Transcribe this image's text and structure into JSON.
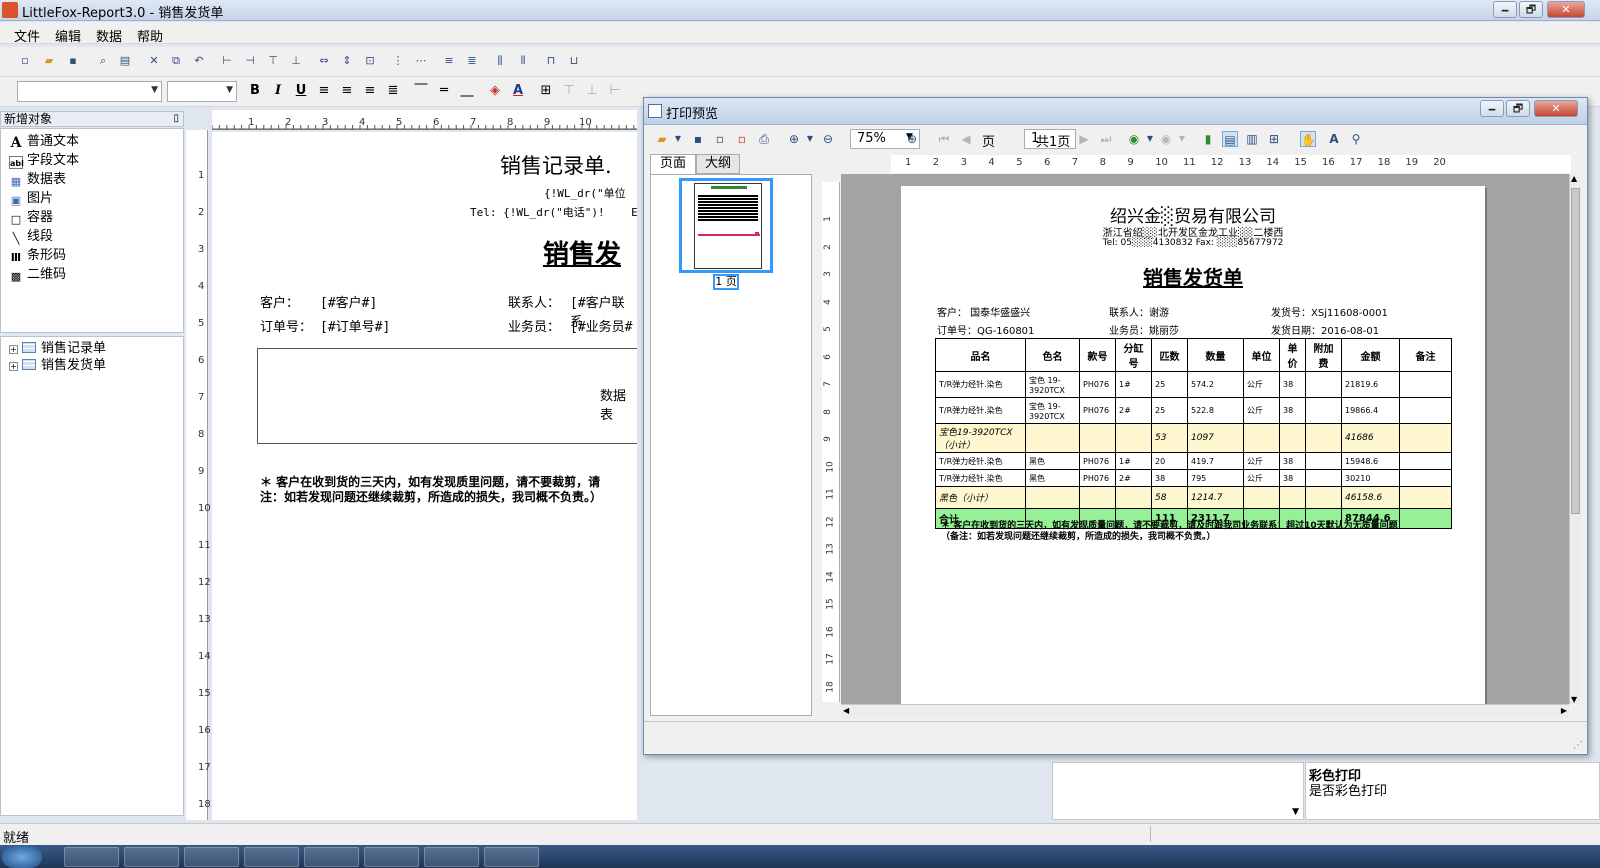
{
  "window": {
    "title": "LittleFox-Report3.0 - 销售发货单",
    "min": "🗕",
    "max": "🗗",
    "close": "✕"
  },
  "menu": [
    "文件",
    "编辑",
    "数据",
    "帮助"
  ],
  "left_panel": {
    "header": "新增对象",
    "pin": "▯",
    "objects": [
      {
        "icon": "A",
        "label": "普通文本"
      },
      {
        "icon": "abl",
        "label": "字段文本"
      },
      {
        "icon": "▦",
        "label": "数据表"
      },
      {
        "icon": "▣",
        "label": "图片"
      },
      {
        "icon": "□",
        "label": "容器"
      },
      {
        "icon": "╲",
        "label": "线段"
      },
      {
        "icon": "Ⅲ",
        "label": "条形码"
      },
      {
        "icon": "▩",
        "label": "二维码"
      }
    ],
    "tree": [
      "销售记录单",
      "销售发货单"
    ]
  },
  "designer": {
    "title": "销售记录单.",
    "field_line1": "{!WL_dr(\"单位",
    "field_line2": "Tel: {!WL_dr(\"电话\")!    E",
    "doc_title": "销售发",
    "customer_label": "客户：",
    "customer_field": "[#客户#]",
    "contact_label": "联系人：",
    "contact_field": "[#客户联系",
    "order_label": "订单号：",
    "order_field": "[#订单号#]",
    "sales_label": "业务员：",
    "sales_field": "[#业务员#",
    "table_placeholder": "数据表",
    "note1": "＊ 客户在收到货的三天内，如有发现质里问题，请不要裁剪，请",
    "note2": "注：如若发现问题还继续裁剪，所造成的损失，我司概不负责。）"
  },
  "ruler_h": [
    "1",
    "2",
    "3",
    "4",
    "5",
    "6",
    "7",
    "8",
    "9",
    "10"
  ],
  "ruler_v": [
    "1",
    "2",
    "3",
    "4",
    "5",
    "6",
    "7",
    "8",
    "9",
    "10",
    "11",
    "12",
    "13",
    "14",
    "15",
    "16",
    "17",
    "18"
  ],
  "status": {
    "text": "就绪"
  },
  "properties": {
    "name": "彩色打印",
    "desc": "是否彩色打印"
  },
  "preview": {
    "title": "打印预览",
    "zoom": "75%",
    "page_label": "页",
    "page_value": "1",
    "total_pages": "共1页",
    "tabs": [
      "页面",
      "大纲"
    ],
    "thumb_label": "1 页",
    "ruler_h": [
      "1",
      "2",
      "3",
      "4",
      "5",
      "6",
      "7",
      "8",
      "9",
      "10",
      "11",
      "12",
      "13",
      "14",
      "15",
      "16",
      "17",
      "18",
      "19",
      "20"
    ],
    "ruler_v": [
      "1",
      "2",
      "3",
      "4",
      "5",
      "6",
      "7",
      "8",
      "9",
      "10",
      "11",
      "12",
      "13",
      "14",
      "15",
      "16",
      "17",
      "18"
    ],
    "company": "绍兴金░贸易有限公司",
    "address": "浙江省绍░░北开发区金龙工业░░二楼西",
    "tel": "Tel: 05░░░4130832     Fax: ░░░85677972",
    "doc_title": "销售发货单",
    "customer": "客户：  国泰华盛盛兴",
    "contact": "联系人：谢游",
    "ship_no": "发货号：XSj11608-0001",
    "order_no": "订单号：QG-160801",
    "salesman": "业务员：姚丽莎",
    "ship_date": "发货日期：2016-08-01",
    "columns": [
      "品名",
      "色名",
      "款号",
      "分缸号",
      "匹数",
      "数量",
      "单位",
      "单价",
      "附加费",
      "金额",
      "备注"
    ],
    "rows": [
      {
        "type": "row",
        "cells": [
          "T/R弹力经针.染色",
          "宝色 19-3920TCX",
          "PH076",
          "1#",
          "25",
          "574.2",
          "公斤",
          "38",
          "",
          "21819.6",
          ""
        ]
      },
      {
        "type": "row",
        "cells": [
          "T/R弹力经针.染色",
          "宝色 19-3920TCX",
          "PH076",
          "2#",
          "25",
          "522.8",
          "公斤",
          "38",
          "",
          "19866.4",
          ""
        ]
      },
      {
        "type": "sub",
        "cells": [
          "宝色19-3920TCX（小计）",
          "",
          "",
          "",
          "53",
          "1097",
          "",
          "",
          "",
          "41686",
          ""
        ]
      },
      {
        "type": "row2",
        "cells": [
          "T/R弹力经针.染色",
          "黑色",
          "PH076",
          "1#",
          "20",
          "419.7",
          "公斤",
          "38",
          "",
          "15948.6",
          ""
        ]
      },
      {
        "type": "row2",
        "cells": [
          "T/R弹力经针.染色",
          "黑色",
          "PH076",
          "2#",
          "38",
          "795",
          "公斤",
          "38",
          "",
          "30210",
          ""
        ]
      },
      {
        "type": "sub",
        "cells": [
          "黑色（小计）",
          "",
          "",
          "",
          "58",
          "1214.7",
          "",
          "",
          "",
          "46158.6",
          ""
        ]
      },
      {
        "type": "total",
        "cells": [
          "合计",
          "",
          "",
          "",
          "111",
          "2311.7",
          "",
          "",
          "",
          "87844.6",
          ""
        ]
      }
    ],
    "note1": "＊ 客户在收到货的三天内，如有发现质量问题，请不要裁剪，请及时跟我司业务联系！超过10天默认为无质量问题",
    "note2": "（备注：如若发现问题还继续裁剪，所造成的损失，我司概不负责。）"
  }
}
